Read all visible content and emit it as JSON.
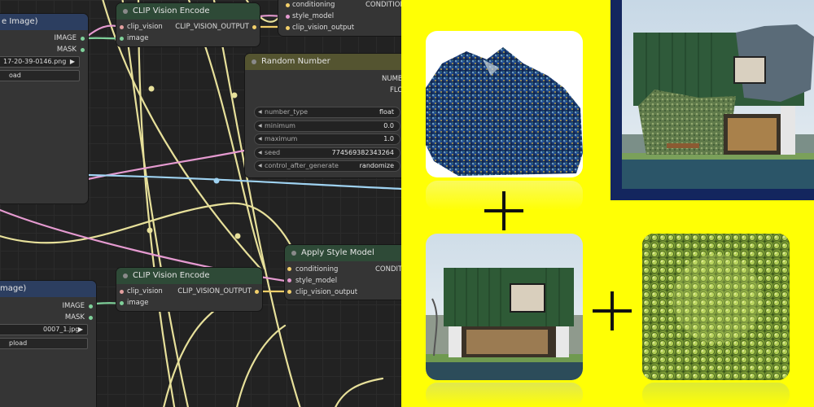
{
  "canvas": {
    "clip_top": {
      "title": "CLIP Vision Encode",
      "in1": "clip_vision",
      "in2": "image",
      "out": "CLIP_VISION_OUTPUT"
    },
    "clip_bottom": {
      "title": "CLIP Vision Encode",
      "in1": "clip_vision",
      "in2": "image",
      "out": "CLIP_VISION_OUTPUT"
    },
    "style_top": {
      "in1": "conditioning",
      "in2": "style_model",
      "in3": "clip_vision_output",
      "out": "CONDITION"
    },
    "style_bottom": {
      "title": "Apply Style Model",
      "in1": "conditioning",
      "in2": "style_model",
      "in3": "clip_vision_output",
      "out": "CONDITI"
    },
    "load_top": {
      "title": "e Image)",
      "out1": "IMAGE",
      "out2": "MASK",
      "filename": "17-20-39-0146.png",
      "upload": "oad"
    },
    "load_bottom": {
      "title": "mage)",
      "out1": "IMAGE",
      "out2": "MASK",
      "filename": "0007_1.jpg",
      "upload": "pload"
    },
    "random": {
      "title": "Random Number",
      "out1": "NUMBE",
      "out2": "FLO",
      "widgets": [
        {
          "label": "number_type",
          "value": "float"
        },
        {
          "label": "minimum",
          "value": "0.0"
        },
        {
          "label": "maximum",
          "value": "1.0"
        },
        {
          "label": "seed",
          "value": "774569382343264"
        },
        {
          "label": "control_after_generate",
          "value": "randomize"
        }
      ]
    }
  },
  "collage": {
    "background": "#ffff05",
    "plus_symbol": "plus-icon",
    "images": [
      "mineral-rock-photo",
      "rock-house-result-photo",
      "green-house-photo",
      "green-seed-texture-photo"
    ]
  }
}
